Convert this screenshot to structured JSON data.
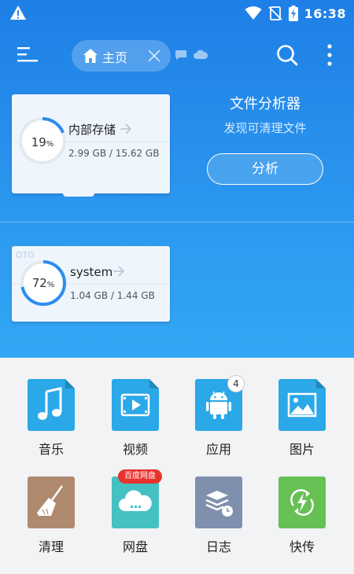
{
  "status_bar": {
    "time": "16:38"
  },
  "toolbar": {
    "tab_label": "主页"
  },
  "storage": {
    "internal": {
      "title": "内部存储",
      "percent_value": 19,
      "percent": "19",
      "unit": "%",
      "size": "2.99 GB / 15.62 GB"
    },
    "otg_label": "OTG",
    "system": {
      "title": "system",
      "percent_value": 72,
      "percent": "72",
      "unit": "%",
      "size": "1.04 GB / 1.44 GB"
    }
  },
  "analyzer": {
    "title": "文件分析器",
    "subtitle": "发现可清理文件",
    "button_label": "分析"
  },
  "categories": [
    {
      "label": "音乐",
      "icon": "music-icon",
      "color": "#2aa8e8"
    },
    {
      "label": "视频",
      "icon": "video-icon",
      "color": "#2aa8e8"
    },
    {
      "label": "应用",
      "icon": "android-icon",
      "color": "#2aa8e8",
      "badge": "4"
    },
    {
      "label": "图片",
      "icon": "image-icon",
      "color": "#2aa8e8"
    },
    {
      "label": "清理",
      "icon": "broom-icon",
      "color": "#b08a6f"
    },
    {
      "label": "网盘",
      "icon": "cloud-icon",
      "color": "#45c1c3",
      "badge": "百度网盘"
    },
    {
      "label": "日志",
      "icon": "log-icon",
      "color": "#7f8fae"
    },
    {
      "label": "快传",
      "icon": "transfer-icon",
      "color": "#66c054"
    }
  ],
  "colors": {
    "accent": "#1e7fe6",
    "ring": "#2b8cf0"
  }
}
